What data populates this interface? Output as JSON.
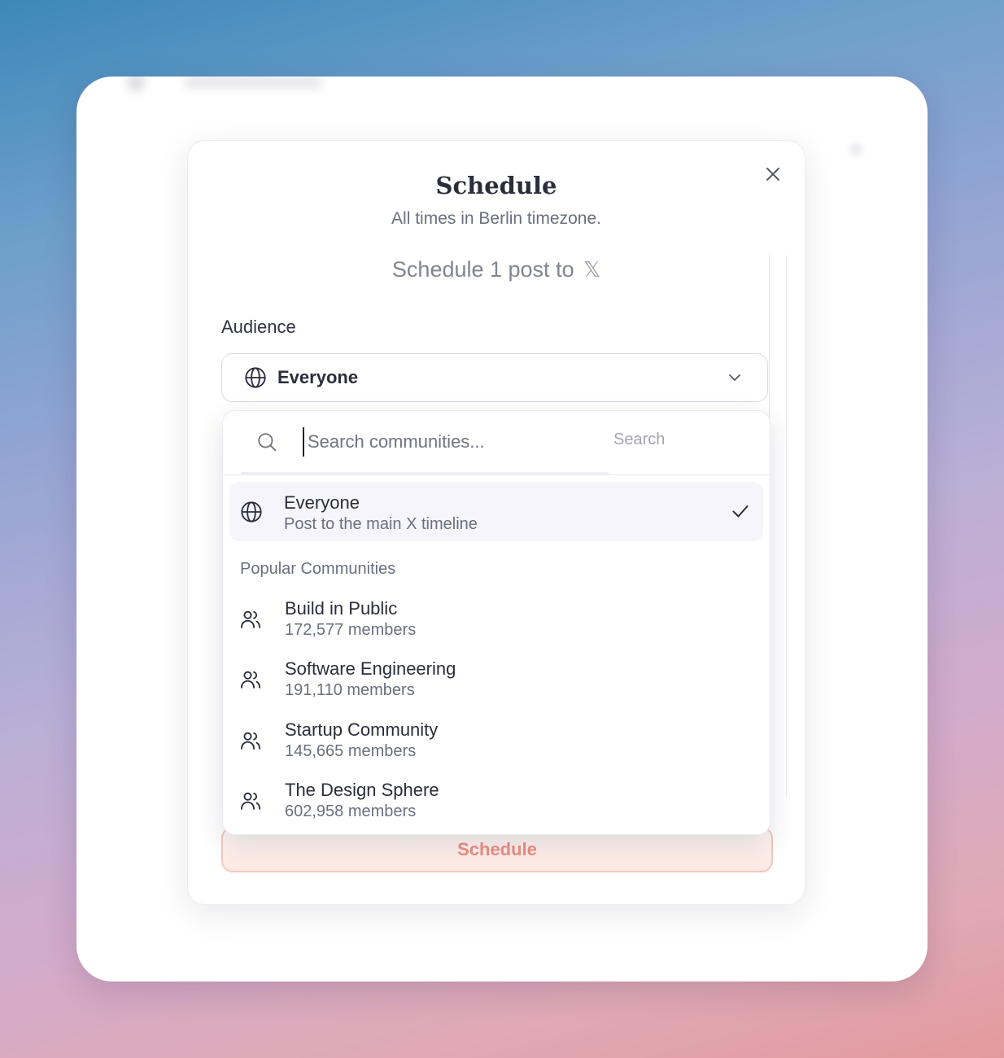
{
  "modal": {
    "title": "Schedule",
    "subtitle": "All times in Berlin timezone.",
    "schedule_text": "Schedule 1 post to",
    "platform_mark": "𝕏",
    "audience_label": "Audience",
    "selected_audience": "Everyone",
    "submit_label": "Schedule"
  },
  "dropdown": {
    "search_placeholder": "Search communities...",
    "search_button": "Search",
    "everyone_option": {
      "title": "Everyone",
      "subtitle": "Post to the main X timeline",
      "selected": true
    },
    "section_label": "Popular Communities",
    "communities": [
      {
        "name": "Build in Public",
        "members": "172,577 members"
      },
      {
        "name": "Software Engineering",
        "members": "191,110 members"
      },
      {
        "name": "Startup Community",
        "members": "145,665 members"
      },
      {
        "name": "The Design Sphere",
        "members": "602,958 members"
      }
    ]
  },
  "icons": {
    "close": "close-icon",
    "globe": "globe-icon",
    "chevron": "chevron-down-icon",
    "search": "search-icon",
    "check": "check-icon",
    "users": "users-icon"
  },
  "colors": {
    "submit_text": "#ec8f84",
    "submit_border": "#f5c8bd",
    "selected_row": "#f5f5fb"
  }
}
